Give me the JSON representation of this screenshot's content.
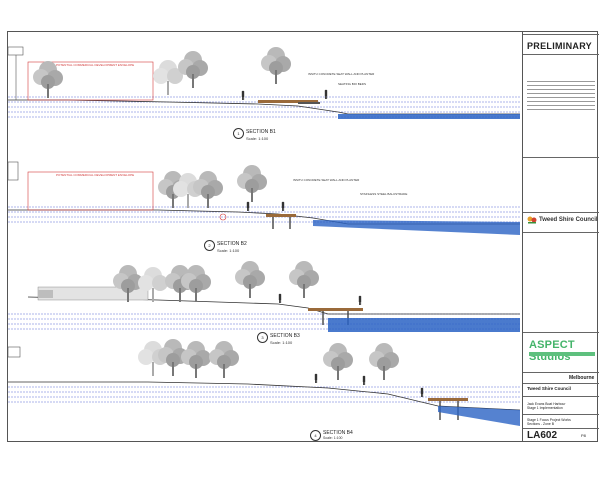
{
  "title_block": {
    "status": "PRELIMINARY",
    "consultant": "ASPECT Studios",
    "office": "Melbourne",
    "council": "Tweed Shire Council",
    "client": "Tweed Shire Council",
    "project_line1": "Jack Evans Boat Harbour",
    "project_line2": "Stage 1 Implementation",
    "stage_line1": "Stage 1 Focus Project Works",
    "stage_line2": "Sections - Zone B",
    "drawing_number": "LA602",
    "revision": "P8"
  },
  "sections": [
    {
      "title": "SECTION B1",
      "scale": "Scale: 1:100",
      "number": "1"
    },
    {
      "title": "SECTION B2",
      "scale": "Scale: 1:100",
      "number": "2"
    },
    {
      "title": "SECTION B3",
      "scale": "Scale: 1:100",
      "number": "3"
    },
    {
      "title": "SECTION B4",
      "scale": "Scale: 1:100",
      "number": "4"
    }
  ],
  "annotations": {
    "commercial": "POTENTIAL COMMERCIAL DEVELOPMENT ENVELOPE",
    "seawall": "INSITU CONCRETE SEAT WALL AND PLANTER",
    "seat": "SEATING BIO BEDS",
    "piles": "STAINLESS STEEL BALUSTRADE"
  },
  "colors": {
    "accent_green": "#44b46a",
    "water_blue": "#2a63c4",
    "datum_blue": "#3344cc",
    "envelope_red": "#d23a3a"
  }
}
